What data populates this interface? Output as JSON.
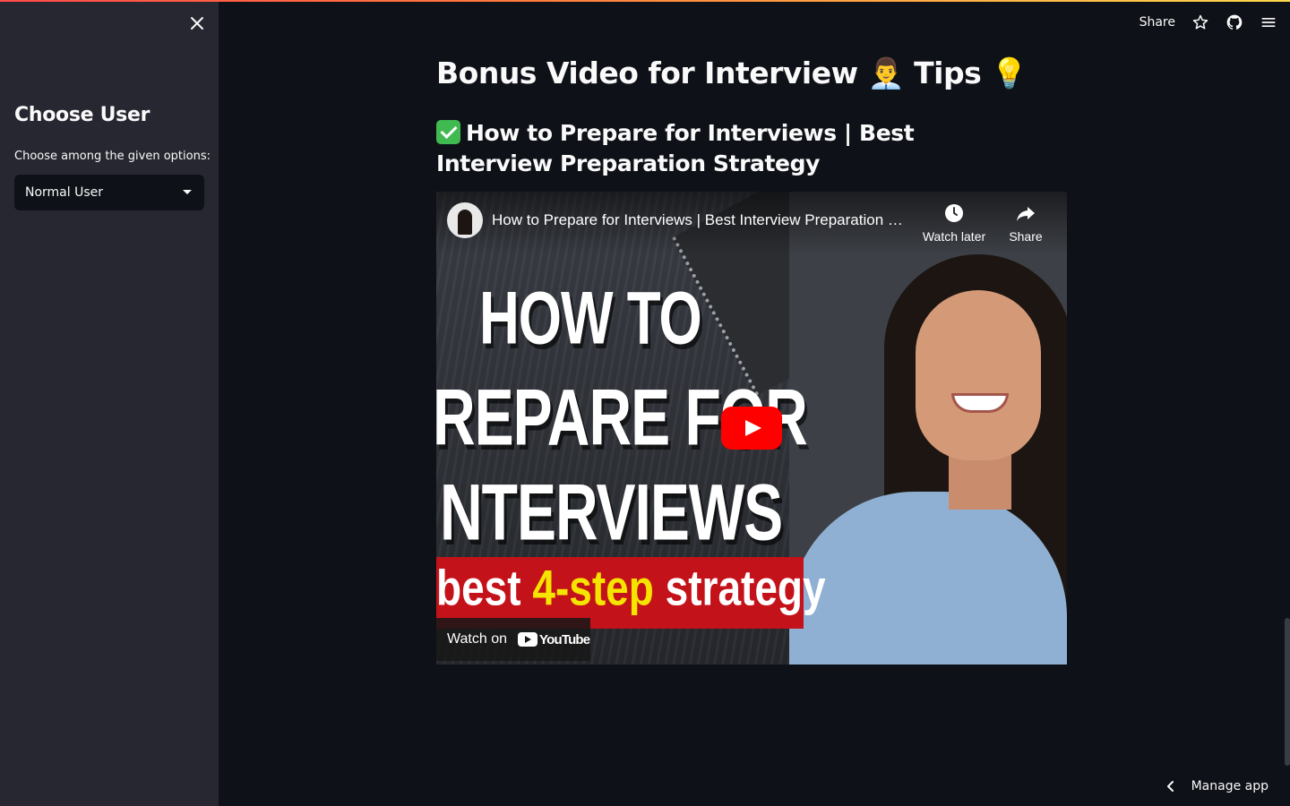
{
  "sidebar": {
    "title": "Choose User",
    "select_label": "Choose among the given options:",
    "selected_value": "Normal User",
    "close_icon": "close-icon"
  },
  "toolbar": {
    "share_label": "Share",
    "icons": [
      "star-icon",
      "github-icon",
      "hamburger-menu-icon"
    ]
  },
  "main": {
    "title": "Bonus Video for Interview 👨‍💼 Tips 💡",
    "subtitle": "How to Prepare for Interviews | Best Interview Preparation Strategy"
  },
  "video": {
    "title": "How to Prepare for Interviews | Best Interview Preparation Strategy",
    "watch_later_label": "Watch later",
    "share_label": "Share",
    "thumb_line1": "HOW TO",
    "thumb_line2": "REPARE FOR",
    "thumb_line3": "NTERVIEWS",
    "band_pre": "best ",
    "band_highlight": "4-step",
    "band_post": " strategy",
    "watch_on_label": "Watch on",
    "youtube_wordmark": "YouTube"
  },
  "footer": {
    "manage_label": "Manage app"
  },
  "colors": {
    "background": "#0e1117",
    "sidebar": "#262730",
    "accent": "#ff4b4b",
    "youtube_red": "#ff0000"
  }
}
